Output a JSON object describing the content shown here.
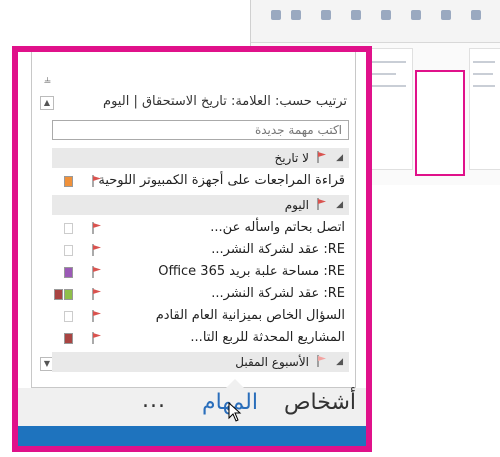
{
  "colors": {
    "highlight": "#e0118a",
    "flag": "#d9534f",
    "accent": "#1e73be",
    "link": "#2a6ebb"
  },
  "panel": {
    "pin_icon": "pin-icon",
    "sort_label": "ترتيب حسب: العلامة: تاريخ الاستحقاق | اليوم",
    "new_task_placeholder": "اكتب مهمة جديدة"
  },
  "groups": [
    {
      "label": "لا تاريخ"
    },
    {
      "label": "اليوم"
    },
    {
      "label": "الأسبوع المقبل"
    }
  ],
  "tasks": [
    {
      "subject": "قراءة المراجعات على أجهزة الكمبيوتر اللوحية",
      "category_color": "#f0913a",
      "category2_color": ""
    },
    {
      "subject": "اتصل بحاتم واسأله عن...",
      "category_color": "",
      "category2_color": ""
    },
    {
      "subject": "RE: عقد لشركة النشر...",
      "category_color": "",
      "category2_color": ""
    },
    {
      "subject": "RE: مساحة علبة بريد Office 365",
      "category_color": "#9b59b6",
      "category2_color": ""
    },
    {
      "subject": "RE: عقد لشركة النشر...",
      "category_color": "#8fbf4a",
      "category2_color": "#a94442"
    },
    {
      "subject": "السؤال الخاص بميزانية العام القادم",
      "category_color": "",
      "category2_color": ""
    },
    {
      "subject": "المشاريع المحدثة للربع التا...",
      "category_color": "#a94442",
      "category2_color": ""
    }
  ],
  "nav": {
    "people": "أشخاص",
    "tasks": "المهام",
    "more": "..."
  }
}
